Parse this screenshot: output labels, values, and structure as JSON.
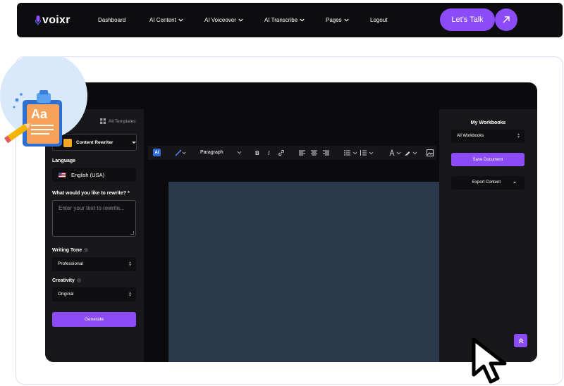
{
  "nav": {
    "logo": "voixr",
    "items": [
      {
        "label": "Dashboard",
        "has_chevron": false
      },
      {
        "label": "AI Content",
        "has_chevron": true
      },
      {
        "label": "AI Voiceover",
        "has_chevron": true
      },
      {
        "label": "AI Transcribe",
        "has_chevron": true
      },
      {
        "label": "Pages",
        "has_chevron": true
      },
      {
        "label": "Logout",
        "has_chevron": false
      }
    ],
    "cta_label": "Let's Talk"
  },
  "left": {
    "all_templates": "All Templates",
    "template": "Content Rewriter",
    "language_label": "Language",
    "language_value": "English (USA)",
    "rewrite_label": "What would you like to rewrite?",
    "rewrite_required": "*",
    "rewrite_placeholder": "Enter your text to rewrite...",
    "tone_label": "Writing Tone",
    "tone_value": "Professional",
    "creativity_label": "Creativity",
    "creativity_value": "Original",
    "generate_label": "Generate"
  },
  "toolbar": {
    "ai_badge": "AI",
    "paragraph": "Paragraph"
  },
  "right": {
    "title": "My Workbooks",
    "workbook_value": "All Workbooks",
    "save_label": "Save Document",
    "export_label": "Export Content"
  },
  "colors": {
    "accent": "#8b4cf7",
    "nav_bg": "#0d0d10",
    "editor_bg": "#2a3a4c",
    "panel_bg": "#18181b"
  }
}
